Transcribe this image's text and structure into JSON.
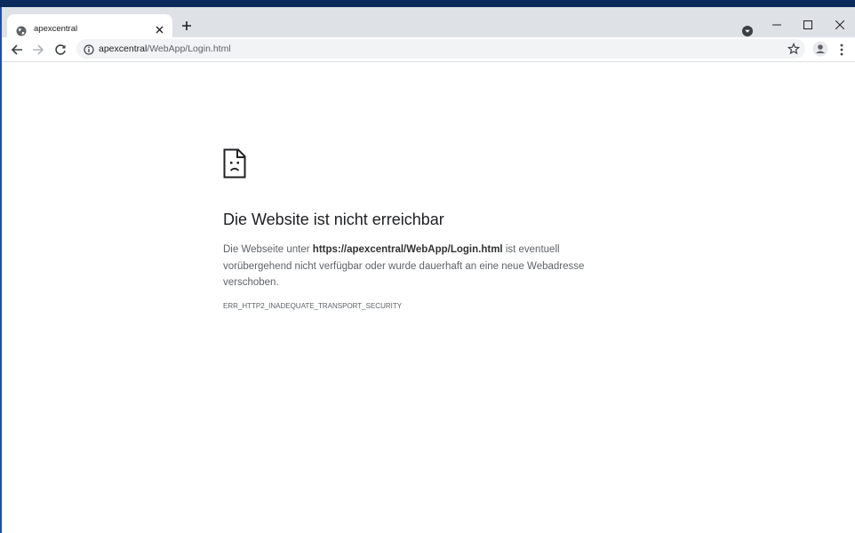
{
  "tab": {
    "title": "apexcentral"
  },
  "omnibox": {
    "host": "apexcentral",
    "path": "/WebApp/Login.html"
  },
  "error": {
    "title": "Die Website ist nicht erreichbar",
    "desc_prefix": "Die Webseite unter ",
    "desc_url": "https://apexcentral/WebApp/Login.html",
    "desc_suffix": " ist eventuell vorübergehend nicht verfügbar oder wurde dauerhaft an eine neue Webadresse verschoben.",
    "code": "ERR_HTTP2_INADEQUATE_TRANSPORT_SECURITY"
  },
  "icons": {
    "favicon": "globe-icon",
    "tab_close": "close-icon",
    "new_tab": "plus-icon",
    "tab_search": "chevron-down-icon",
    "back": "back-arrow-icon",
    "forward": "forward-arrow-icon",
    "reload": "reload-icon",
    "site_info": "info-icon",
    "bookmark": "star-icon",
    "profile": "person-icon",
    "menu": "kebab-menu-icon",
    "error": "sad-page-icon"
  },
  "colors": {
    "titlebar": "#dee1e6",
    "omnibox": "#f1f3f4",
    "text": "#202124",
    "muted": "#5f6368"
  }
}
